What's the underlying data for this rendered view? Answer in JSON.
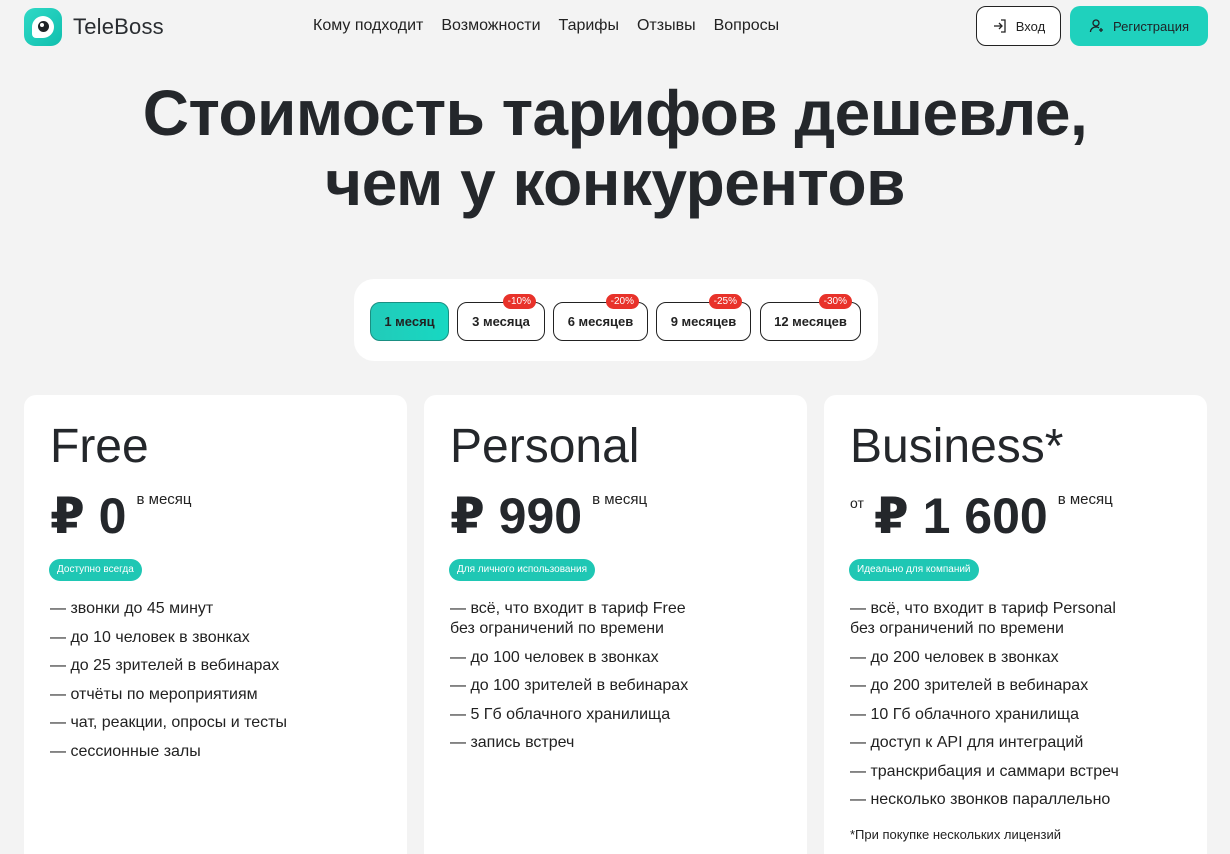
{
  "brand": {
    "name": "TeleBoss",
    "accent": "#1fd1bd"
  },
  "nav": [
    {
      "label": "Кому подходит"
    },
    {
      "label": "Возможности"
    },
    {
      "label": "Тарифы"
    },
    {
      "label": "Отзывы"
    },
    {
      "label": "Вопросы"
    }
  ],
  "header": {
    "login_label": "Вход",
    "register_label": "Регистрация"
  },
  "hero": {
    "line1": "Стоимость тарифов дешевле,",
    "line2": "чем у конкурентов"
  },
  "periods": [
    {
      "label": "1 месяц",
      "badge": "",
      "active": true
    },
    {
      "label": "3 месяца",
      "badge": "-10%"
    },
    {
      "label": "6 месяцев",
      "badge": "-20%"
    },
    {
      "label": "9 месяцев",
      "badge": "-25%"
    },
    {
      "label": "12 месяцев",
      "badge": "-30%"
    }
  ],
  "plans": [
    {
      "name": "Free",
      "price_prefix": "",
      "price": "₽ 0",
      "period": "в месяц",
      "tag": "Доступно всегда",
      "features": [
        "— звонки до 45 минут",
        "— до 10 человек в звонках",
        "— до 25 зрителей в вебинарах",
        "— отчёты по мероприятиям",
        "— чат, реакции, опросы и тесты",
        "— сессионные залы"
      ],
      "footnote": ""
    },
    {
      "name": "Personal",
      "price_prefix": "",
      "price": "₽ 990",
      "period": "в месяц",
      "tag": "Для личного использования",
      "features": [
        "— всё, что входит в тариф Free\nбез ограничений по времени",
        "— до 100 человек в звонках",
        "— до 100 зрителей в вебинарах",
        "— 5 Гб облачного хранилища",
        "— запись встреч"
      ],
      "footnote": ""
    },
    {
      "name": "Business*",
      "price_prefix": "от",
      "price": "₽ 1 600",
      "period": "в месяц",
      "tag": "Идеально для компаний",
      "features": [
        "— всё, что входит в тариф Personal\nбез ограничений по времени",
        "— до 200 человек в звонках",
        "— до 200 зрителей в вебинарах",
        "— 10 Гб облачного хранилища",
        "— доступ к API для интеграций",
        "— транскрибация и саммари встреч",
        "— несколько звонков параллельно"
      ],
      "footnote": "*При покупке нескольких лицензий"
    }
  ]
}
